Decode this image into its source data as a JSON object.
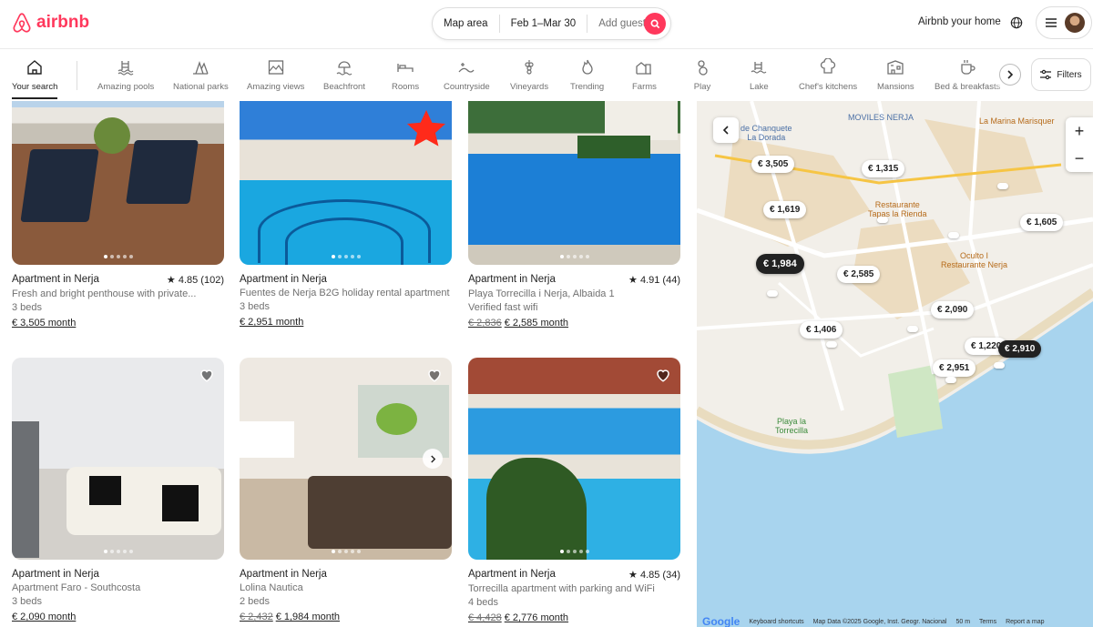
{
  "header": {
    "logo_text": "airbnb",
    "search": {
      "location": "Map area",
      "dates": "Feb 1–Mar 30",
      "guests": "Add guests"
    },
    "host_link": "Airbnb your home"
  },
  "categories": [
    {
      "label": "Your search",
      "icon": "house-icon",
      "active": true
    },
    {
      "label": "Amazing pools",
      "icon": "pool-icon"
    },
    {
      "label": "National parks",
      "icon": "park-icon"
    },
    {
      "label": "Amazing views",
      "icon": "view-icon"
    },
    {
      "label": "Beachfront",
      "icon": "beach-icon"
    },
    {
      "label": "Rooms",
      "icon": "bed-icon"
    },
    {
      "label": "Countryside",
      "icon": "countryside-icon"
    },
    {
      "label": "Vineyards",
      "icon": "grapes-icon"
    },
    {
      "label": "Trending",
      "icon": "flame-icon"
    },
    {
      "label": "Farms",
      "icon": "farm-icon"
    },
    {
      "label": "Play",
      "icon": "play-icon"
    },
    {
      "label": "Lake",
      "icon": "lake-icon"
    },
    {
      "label": "Chef's kitchens",
      "icon": "chef-hat-icon"
    },
    {
      "label": "Mansions",
      "icon": "mansion-icon"
    },
    {
      "label": "Bed & breakfasts",
      "icon": "coffee-icon"
    }
  ],
  "filters_label": "Filters",
  "listings": [
    {
      "title": "Apartment in Nerja",
      "rating": "4.85 (102)",
      "line1": "Fresh and bright penthouse with private...",
      "line2": "3 beds",
      "old_price": "",
      "price": "€ 3,505 month"
    },
    {
      "title": "Apartment in Nerja",
      "rating": "",
      "line1": "Fuentes de Nerja B2G holiday rental apartment",
      "line2": "3 beds",
      "old_price": "",
      "price": "€ 2,951 month"
    },
    {
      "title": "Apartment in Nerja",
      "rating": "4.91 (44)",
      "line1": "Playa Torrecilla i Nerja, Albaida 1",
      "line2": "Verified fast wifi",
      "old_price": "€ 2,836",
      "price": "€ 2,585 month"
    },
    {
      "title": "Apartment in Nerja",
      "rating": "",
      "line1": "Apartment Faro - Southcosta",
      "line2": "3 beds",
      "old_price": "",
      "price": "€ 2,090 month"
    },
    {
      "title": "Apartment in Nerja",
      "rating": "",
      "line1": "Lolina Nautica",
      "line2": "2 beds",
      "old_price": "€ 2,432",
      "price": "€ 1,984 month"
    },
    {
      "title": "Apartment in Nerja",
      "rating": "4.85 (34)",
      "line1": "Torrecilla apartment with parking and WiFi",
      "line2": "4 beds",
      "old_price": "€ 4,428",
      "price": "€ 2,776 month"
    }
  ],
  "map": {
    "pins": [
      {
        "label": "€ 3,505"
      },
      {
        "label": "€ 1,315"
      },
      {
        "label": "€ 1,619"
      },
      {
        "label": "€ 1,605"
      },
      {
        "label": "€ 1,984",
        "dark": true
      },
      {
        "label": "€ 2,585"
      },
      {
        "label": "€ 2,090"
      },
      {
        "label": "€ 1,406"
      },
      {
        "label": "€ 1,220"
      },
      {
        "label": "€ 2,910",
        "dark": true
      },
      {
        "label": "€ 2,951"
      }
    ],
    "pois": {
      "chanquete": "de Chanquete\nLa Dorada",
      "moviles": "MOVILES NERJA",
      "marina": "La Marina Marisquer",
      "restaurante": "Restaurante\nTapas la Rienda",
      "oculto": "Oculto I\nRestaurante Nerja",
      "playa": "Playa la\nTorrecilla"
    },
    "footer": {
      "google": "Google",
      "shortcuts": "Keyboard shortcuts",
      "mapdata": "Map Data ©2025 Google, Inst. Geogr. Nacional",
      "scale": "50 m",
      "terms": "Terms",
      "report": "Report a map"
    }
  }
}
